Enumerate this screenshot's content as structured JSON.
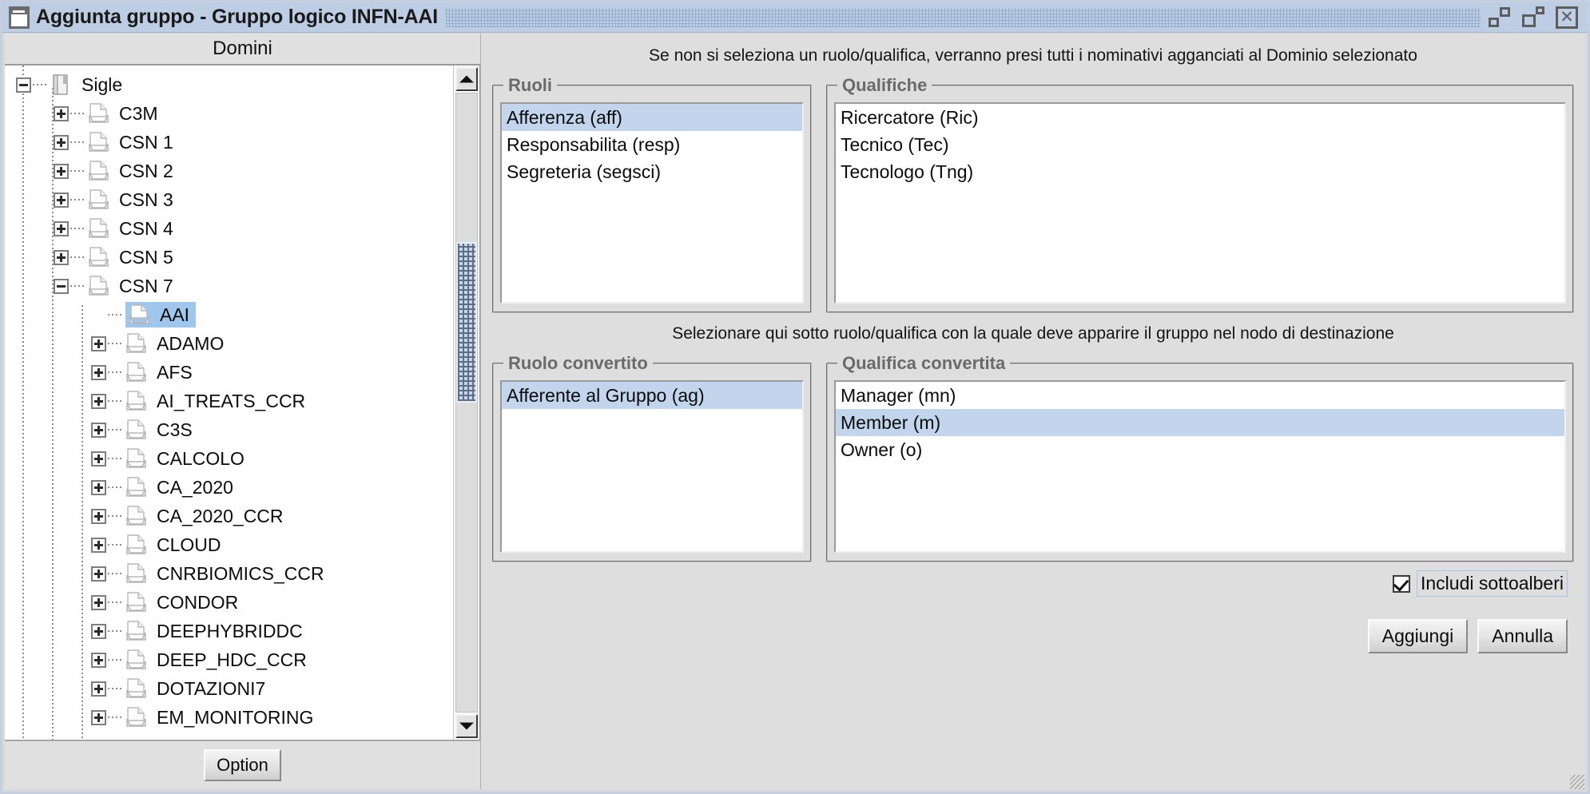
{
  "window": {
    "title": "Aggiunta gruppo - Gruppo logico INFN-AAI",
    "icon": "window-app-icon",
    "buttons": {
      "restore": "restore-down",
      "maximize": "maximize",
      "close": "close"
    }
  },
  "left": {
    "header": "Domini",
    "option_button": "Option",
    "scrollbar": {
      "up": "scroll-up",
      "down": "scroll-down"
    },
    "tree": [
      {
        "label": "Sigle",
        "depth": 0,
        "knob": "minus",
        "icon": "book-icon",
        "selected": false
      },
      {
        "label": "C3M",
        "depth": 1,
        "knob": "plus",
        "icon": "document-icon",
        "selected": false
      },
      {
        "label": "CSN 1",
        "depth": 1,
        "knob": "plus",
        "icon": "document-icon",
        "selected": false
      },
      {
        "label": "CSN 2",
        "depth": 1,
        "knob": "plus",
        "icon": "document-icon",
        "selected": false
      },
      {
        "label": "CSN 3",
        "depth": 1,
        "knob": "plus",
        "icon": "document-icon",
        "selected": false
      },
      {
        "label": "CSN 4",
        "depth": 1,
        "knob": "plus",
        "icon": "document-icon",
        "selected": false
      },
      {
        "label": "CSN 5",
        "depth": 1,
        "knob": "plus",
        "icon": "document-icon",
        "selected": false
      },
      {
        "label": "CSN 7",
        "depth": 1,
        "knob": "minus",
        "icon": "document-icon",
        "selected": false
      },
      {
        "label": "AAI",
        "depth": 2,
        "knob": "none",
        "icon": "document-icon",
        "selected": true
      },
      {
        "label": "ADAMO",
        "depth": 2,
        "knob": "plus",
        "icon": "document-icon",
        "selected": false
      },
      {
        "label": "AFS",
        "depth": 2,
        "knob": "plus",
        "icon": "document-icon",
        "selected": false
      },
      {
        "label": "AI_TREATS_CCR",
        "depth": 2,
        "knob": "plus",
        "icon": "document-icon",
        "selected": false
      },
      {
        "label": "C3S",
        "depth": 2,
        "knob": "plus",
        "icon": "document-icon",
        "selected": false
      },
      {
        "label": "CALCOLO",
        "depth": 2,
        "knob": "plus",
        "icon": "document-icon",
        "selected": false
      },
      {
        "label": "CA_2020",
        "depth": 2,
        "knob": "plus",
        "icon": "document-icon",
        "selected": false
      },
      {
        "label": "CA_2020_CCR",
        "depth": 2,
        "knob": "plus",
        "icon": "document-icon",
        "selected": false
      },
      {
        "label": "CLOUD",
        "depth": 2,
        "knob": "plus",
        "icon": "document-icon",
        "selected": false
      },
      {
        "label": "CNRBIOMICS_CCR",
        "depth": 2,
        "knob": "plus",
        "icon": "document-icon",
        "selected": false
      },
      {
        "label": "CONDOR",
        "depth": 2,
        "knob": "plus",
        "icon": "document-icon",
        "selected": false
      },
      {
        "label": "DEEPHYBRIDDC",
        "depth": 2,
        "knob": "plus",
        "icon": "document-icon",
        "selected": false
      },
      {
        "label": "DEEP_HDC_CCR",
        "depth": 2,
        "knob": "plus",
        "icon": "document-icon",
        "selected": false
      },
      {
        "label": "DOTAZIONI7",
        "depth": 2,
        "knob": "plus",
        "icon": "document-icon",
        "selected": false
      },
      {
        "label": "EM_MONITORING",
        "depth": 2,
        "knob": "plus",
        "icon": "document-icon",
        "selected": false
      }
    ]
  },
  "right": {
    "top_hint": "Se non si seleziona un ruolo/qualifica, verranno presi tutti i nominativi agganciati al Dominio selezionato",
    "mid_hint": "Selezionare qui sotto ruolo/qualifica con la quale deve apparire il gruppo nel nodo di destinazione",
    "ruoli": {
      "legend": "Ruoli",
      "items": [
        {
          "label": "Afferenza (aff)",
          "selected": true
        },
        {
          "label": "Responsabilita (resp)",
          "selected": false
        },
        {
          "label": "Segreteria (segsci)",
          "selected": false
        }
      ]
    },
    "qualifiche": {
      "legend": "Qualifiche",
      "items": [
        {
          "label": "Ricercatore (Ric)",
          "selected": false
        },
        {
          "label": "Tecnico (Tec)",
          "selected": false
        },
        {
          "label": "Tecnologo (Tng)",
          "selected": false
        }
      ]
    },
    "ruolo_convertito": {
      "legend": "Ruolo convertito",
      "items": [
        {
          "label": "Afferente al Gruppo (ag)",
          "selected": true
        }
      ]
    },
    "qualifica_convertita": {
      "legend": "Qualifica convertita",
      "items": [
        {
          "label": "Manager (mn)",
          "selected": false
        },
        {
          "label": "Member (m)",
          "selected": true
        },
        {
          "label": "Owner (o)",
          "selected": false
        }
      ]
    },
    "include_subtrees": {
      "label": "Includi sottoalberi",
      "checked": true
    },
    "buttons": {
      "confirm": "Aggiungi",
      "cancel": "Annulla"
    }
  },
  "colors": {
    "titlebar": "#bdcde4",
    "selection": "#c2d5ed",
    "tree_selection": "#9fc6ec",
    "face": "#dedede",
    "legend_text": "#6a6a6a"
  }
}
